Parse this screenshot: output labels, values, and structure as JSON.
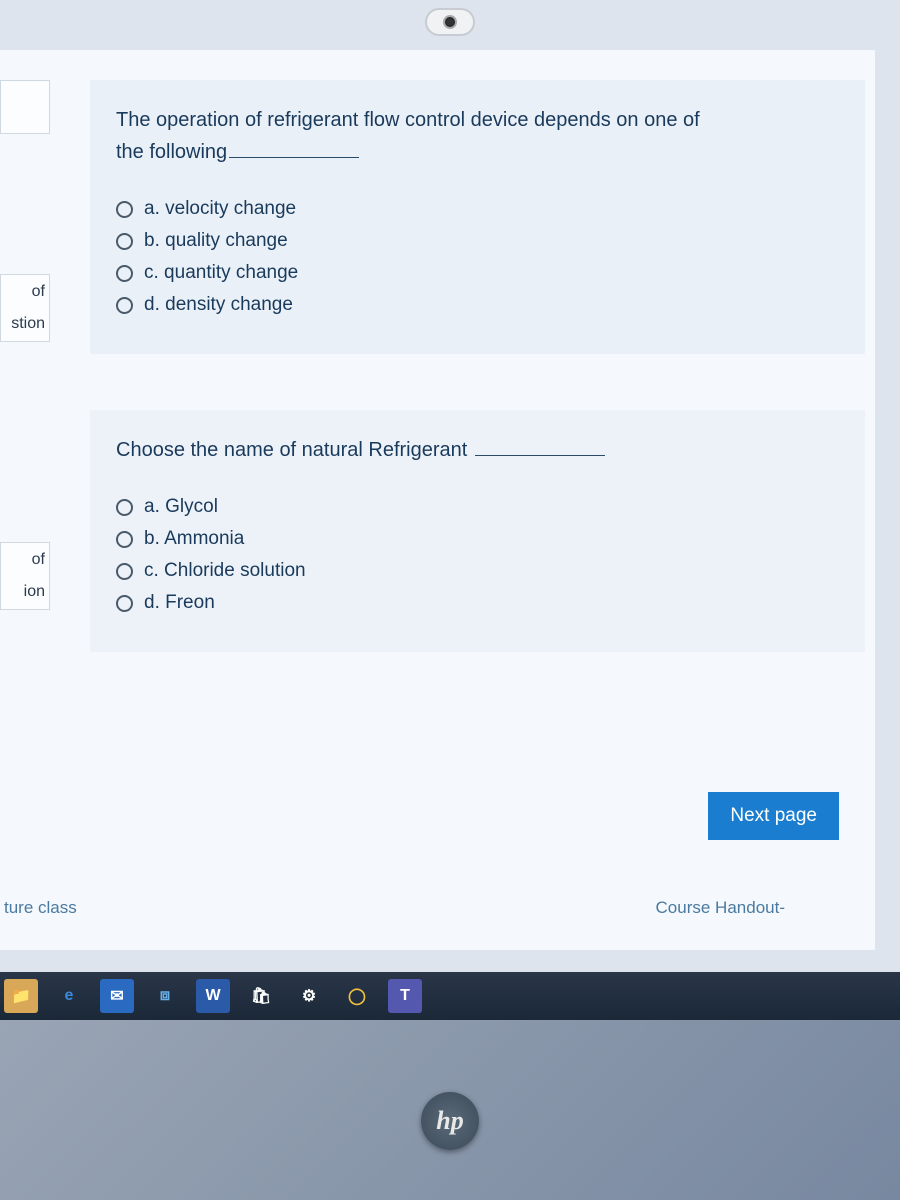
{
  "camera_label": "webcam",
  "sidebar": {
    "block1": "",
    "block2_line1": "of",
    "block2_line2": "stion",
    "block3_line1": "of",
    "block3_line2": "ion"
  },
  "questions": [
    {
      "prompt_line1": "The operation of refrigerant flow control device depends on one of",
      "prompt_line2": "the following",
      "has_blank": true,
      "options": [
        {
          "label": "a. velocity change"
        },
        {
          "label": "b. quality change"
        },
        {
          "label": "c. quantity change"
        },
        {
          "label": "d. density change"
        }
      ]
    },
    {
      "prompt_line1": "Choose the name of natural Refrigerant",
      "prompt_line2": "",
      "has_blank": true,
      "options": [
        {
          "label": "a. Glycol"
        },
        {
          "label": "b. Ammonia"
        },
        {
          "label": "c. Chloride solution"
        },
        {
          "label": "d. Freon"
        }
      ]
    }
  ],
  "buttons": {
    "next_page": "Next page"
  },
  "footer": {
    "left_link": "ture class",
    "right_link": "Course Handout-"
  },
  "taskbar": {
    "icons": [
      {
        "name": "file-explorer-icon",
        "glyph": "📁",
        "bg": "#d8a858"
      },
      {
        "name": "edge-icon",
        "glyph": "e",
        "color": "#3a88d8"
      },
      {
        "name": "mail-icon",
        "glyph": "✉",
        "bg": "#2a6ac0",
        "color": "#fff"
      },
      {
        "name": "dropbox-icon",
        "glyph": "⧈",
        "color": "#68b0e8"
      },
      {
        "name": "word-icon",
        "glyph": "W",
        "bg": "#2a5aa8",
        "color": "#fff"
      },
      {
        "name": "store-icon",
        "glyph": "🛍",
        "color": "#fff"
      },
      {
        "name": "settings-icon",
        "glyph": "⚙",
        "color": "#fff"
      },
      {
        "name": "chrome-icon",
        "glyph": "◯",
        "color": "#f0c040"
      },
      {
        "name": "teams-icon",
        "glyph": "T",
        "bg": "#5558af",
        "color": "#fff"
      }
    ]
  },
  "hp_logo": "hp"
}
